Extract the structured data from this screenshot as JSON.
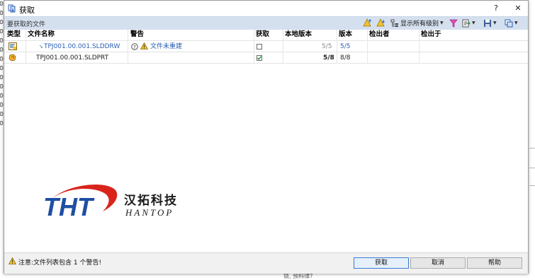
{
  "window": {
    "title": "获取",
    "help_label": "?",
    "close_label": "✕"
  },
  "toolbar": {
    "section_label": "要获取的文件",
    "show_levels_label": "显示所有级别"
  },
  "table": {
    "columns": [
      "类型",
      "文件名称",
      "警告",
      "获取",
      "本地版本",
      "版本",
      "检出者",
      "检出于"
    ],
    "rows": [
      {
        "type_icon": "drawing-icon",
        "filename": "TPJ001.00.001.SLDDRW",
        "warning": "文件未重建",
        "get_checked": false,
        "local_version": "5/5",
        "version": "5/5",
        "checked_out_by": "",
        "checked_out_in": ""
      },
      {
        "type_icon": "part-icon",
        "filename": "TPJ001.00.001.SLDPRT",
        "warning": "",
        "get_checked": true,
        "local_version": "5/8",
        "version": "8/8",
        "checked_out_by": "",
        "checked_out_in": ""
      }
    ]
  },
  "logo": {
    "mark": "THT",
    "name_cn": "汉拓科技",
    "name_en": "HANTOP",
    "colors": {
      "blue": "#1f4fa3",
      "red": "#d9241c"
    }
  },
  "status": {
    "text": "注意:文件列表包含 1 个警告!"
  },
  "buttons": {
    "get": "获取",
    "cancel": "取消",
    "help": "帮助"
  },
  "background": {
    "left_glyphs": [
      "D",
      "D",
      "D",
      "D",
      "D",
      "D",
      "D",
      "D",
      "D",
      "D",
      "D",
      "D",
      "D",
      "D"
    ],
    "bottom_text": "锁, 预科律?"
  }
}
